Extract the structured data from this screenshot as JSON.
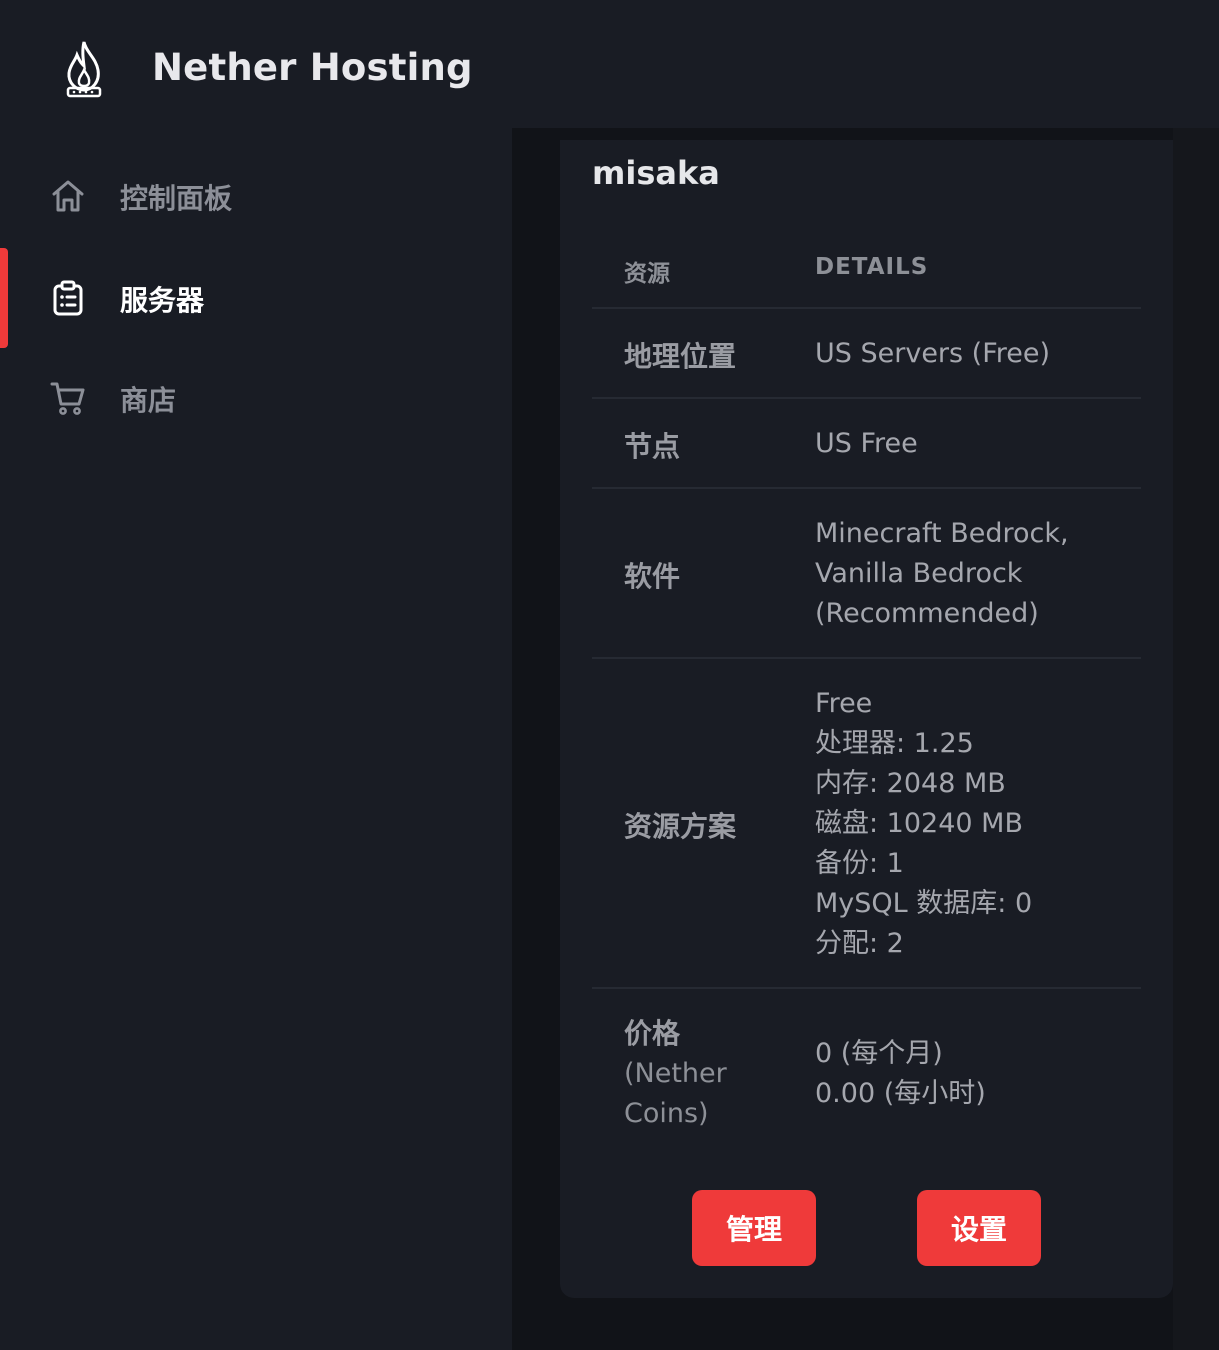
{
  "app": {
    "brand": "Nether Hosting",
    "logo_icon": "fire-icon"
  },
  "sidebar": {
    "items": [
      {
        "label": "控制面板",
        "icon": "home-icon",
        "active": false
      },
      {
        "label": "服务器",
        "icon": "clipboard-list-icon",
        "active": true
      },
      {
        "label": "商店",
        "icon": "cart-icon",
        "active": false
      }
    ]
  },
  "server": {
    "name": "misaka",
    "table_headers": {
      "resource": "资源",
      "details": "DETAILS"
    },
    "rows": {
      "location": {
        "label": "地理位置",
        "value": "US Servers (Free)"
      },
      "node": {
        "label": "节点",
        "value": "US Free"
      },
      "software": {
        "label": "软件",
        "lines": [
          "Minecraft Bedrock,",
          "Vanilla Bedrock",
          "(Recommended)"
        ]
      },
      "plan": {
        "label": "资源方案",
        "lines": [
          "Free",
          "处理器: 1.25",
          "内存: 2048 MB",
          "磁盘: 10240 MB",
          "备份: 1",
          "MySQL 数据库: 0",
          "分配: 2"
        ]
      },
      "price": {
        "label": "价格",
        "sub_lines": [
          "(Nether",
          "Coins)"
        ],
        "lines": [
          "0 (每个月)",
          "0.00 (每小时)"
        ]
      }
    },
    "buttons": {
      "manage": "管理",
      "settings": "设置"
    }
  },
  "colors": {
    "accent": "#ef3a3a",
    "panel": "#191c24",
    "background": "#111318"
  }
}
